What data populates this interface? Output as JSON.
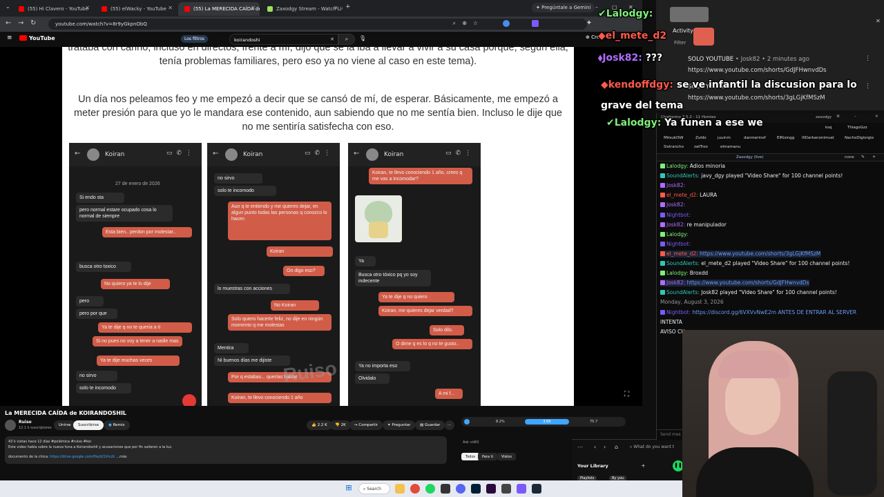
{
  "browser": {
    "tabs": [
      {
        "label": "(55) Hi Clavero - YouTube"
      },
      {
        "label": "(55) elWacky - YouTube"
      },
      {
        "label": "(55) La MERECIDA CAÍDA de K"
      },
      {
        "label": "Zaxodgy Stream - Watch Live o"
      }
    ],
    "gemini_label": "Pregúntale a Gemini",
    "url": "youtube.com/watch?v=8r9yGkpnObQ"
  },
  "youtube": {
    "logo": "YouTube",
    "filters_label": "Los filtros",
    "search_value": "koirandoshi",
    "video": {
      "paragraph1": "trataba con cariño; incluso en directos, frente a mí, dijo que se la iba a llevar a vivir a su casa porque, según ella, tenía problemas familiares, pero eso ya no viene al caso en este tema).",
      "paragraph2": "Un día nos peleamos feo y me empezó a decir que se cansó de mí, de esperar. Básicamente, me empezó a meter presión para que yo le mandara ese contenido, aun sabiendo que no me sentía bien. Incluso le dije que no me sentiría satisfecha con eso.",
      "phone_contact": "Koiran",
      "watermark": "Ruiso",
      "phone1": [
        "27 de enero de 2026",
        "Si endo sta",
        "pero normal estare ocupado cosa lo normal de siempre",
        "Esta bien.. perdon por molestar..",
        "busca otro toxico",
        "No quiero ya te lo dije",
        "pero",
        "pero por que",
        "Ya te dije q no te quería a ti",
        "Si no pues no voy a tener a nadie mas",
        "Ya te dije muchas veces",
        "no sirvo",
        "solo te incomodo"
      ],
      "phone2": [
        "no sirvo",
        "solo te incomodo",
        "Aun q te entiendo y me quieres dejar, en algun punto todas las personas q conozco lo hacen",
        "Koiran",
        "On digo eso?",
        "lo muestras con acciones",
        "No Koiran",
        "Solo quiero hacerte feliz, no dije en ningún momento q me molestas",
        "Mentira",
        "Ni buenos días me dijiste",
        "Por q estabas... querías hablar",
        "Koiran, te llevo conociendo 1 año"
      ],
      "phone3": [
        "Koiran, te llevo conociendo 1 año, crees q me vas a incomodar?",
        "Ya",
        "Busca otro tóxico pq yo soy indecente",
        "Ya te dije q no quiero",
        "Koiran, me quieres dejar verdad?",
        "Solo dilo.",
        "O dime q es lo q no te gusto..",
        "Ya no importa eso",
        "Olvidalo",
        "A mi f..."
      ]
    },
    "title": "La MERECIDA CAÍDA de KOIRANDOSHIL",
    "channel": {
      "name": "Ruiso",
      "subs": "12.1 k suscriptores"
    },
    "buttons": {
      "join": "Unirse",
      "subscribe": "Suscribirse",
      "remix": "Remix",
      "likes": "2.2 K",
      "dislikes": "2K",
      "share": "Compartir",
      "ask": "Preguntar",
      "save": "Guardar"
    },
    "description": {
      "stats": "43 k vistas  hace 12 días  #polémica #ruiso #koi",
      "line1": "Este video habla sobre la nueva funa a Koirandoshil y acusaciones que por fin salieron a la luz.",
      "doc_label": "documento de la chica:",
      "doc_link": "https://drive.google.com/file/d/1Vm2c",
      "more": "...más"
    },
    "player": {
      "left": "8.2%",
      "mid": "3.6K",
      "right": "75.7"
    },
    "ask_placeholder": "Ask vidIQ",
    "chips": [
      "Todos",
      "Para ti",
      "Vistos"
    ],
    "library": {
      "title": "Your Library",
      "search": "What do you want t",
      "tabs": [
        "Playlists",
        "By you"
      ]
    }
  },
  "overlay_chat": [
    {
      "user": "Lalodgy:",
      "text": "",
      "color": "#7ef07a"
    },
    {
      "user": "el_mete_d2",
      "text": "",
      "color": "#ff5a4a"
    },
    {
      "user": "Josk82:",
      "text": "???",
      "color": "#b06cff"
    },
    {
      "user": "kendoffdgy:",
      "text": "se ve infantil la discusion para lo grave del tema",
      "color": "#ff5a4a"
    },
    {
      "user": "Lalodgy:",
      "text": "Ya funen a ese we",
      "color": "#7ef07a"
    }
  ],
  "notifications": {
    "activity_label": "Activity Fe",
    "filter_label": "Filter",
    "item1_title": "SOLO YOUTUBE",
    "item1_meta": "• Josk82 • 2 minutes ago",
    "item1_url": "https://www.youtube.com/shorts/GdJFHwnvdDs",
    "item2_title": "SOLO YOUTUBE",
    "item2_url": "https://www.youtube.com/shorts/3gLGjKfMSzM"
  },
  "chatterino": {
    "title": "Chatterino 7.5.2 - 11 Homies",
    "user_tab": "zaxodgy",
    "tabs_row1": [
      "MitsukiSW",
      "Zuldo",
      "juuinm",
      "danmerinof",
      "ElRisingg",
      "IllDarkanonimuel",
      "NachoDigiorgio"
    ],
    "tabs_row2": [
      "Sistrancho",
      "zatTroo",
      "elmamanu"
    ],
    "tabs_right": [
      "ksq",
      "ThiagoGzz"
    ],
    "split_name": "Zaxodgy (live)",
    "split_right": "none",
    "messages": [
      {
        "user": "Lalodgy:",
        "text": "Adios minoria",
        "color": "#7ef07a"
      },
      {
        "user": "SoundAlerts:",
        "text": "javy_dgy played \"Video Share\" for 100 channel points!",
        "color": "#31c7b8"
      },
      {
        "user": "Josk82:",
        "text": "",
        "color": "#b06cff"
      },
      {
        "user": "el_mete_d2:",
        "text": "LAURA",
        "color": "#ff5a4a"
      },
      {
        "user": "Josk82:",
        "text": "",
        "color": "#b06cff"
      },
      {
        "user": "Nightbot:",
        "text": "",
        "color": "#7a5af8"
      },
      {
        "user": "Josk82:",
        "text": "re manipulador",
        "color": "#b06cff"
      },
      {
        "user": "Lalodgy:",
        "text": "",
        "color": "#7ef07a"
      },
      {
        "user": "Nightbot:",
        "text": "",
        "color": "#7a5af8"
      },
      {
        "user": "el_mete_d2:",
        "text": "https://www.youtube.com/shorts/3gLGjKfMSzM",
        "color": "#ff5a4a"
      },
      {
        "user": "SoundAlerts:",
        "text": "el_mete_d2 played \"Video Share\" for 100 channel points!",
        "color": "#31c7b8"
      },
      {
        "user": "Lalodgy:",
        "text": "Broxdd",
        "color": "#7ef07a"
      },
      {
        "user": "Josk82:",
        "text": "https://www.youtube.com/shorts/GdJFHwnvdDs",
        "color": "#b06cff"
      },
      {
        "user": "SoundAlerts:",
        "text": "Josk82 played \"Video Share\" for 100 channel points!",
        "color": "#31c7b8"
      },
      {
        "user": "",
        "text": "Monday, August 3, 2026",
        "color": "#999999"
      },
      {
        "user": "Nightbot:",
        "text": "https://discord.gg/6VXVvNwE2m ANTES DE ENTRAR AL SERVER",
        "color": "#7a5af8"
      },
      {
        "user": "",
        "text": "INTENTA",
        "color": "#eeeeee"
      },
      {
        "user": "",
        "text": "AVISO CU",
        "color": "#eeeeee"
      }
    ],
    "input_placeholder": "Send mes"
  },
  "taskbar": {
    "search": "Search"
  }
}
